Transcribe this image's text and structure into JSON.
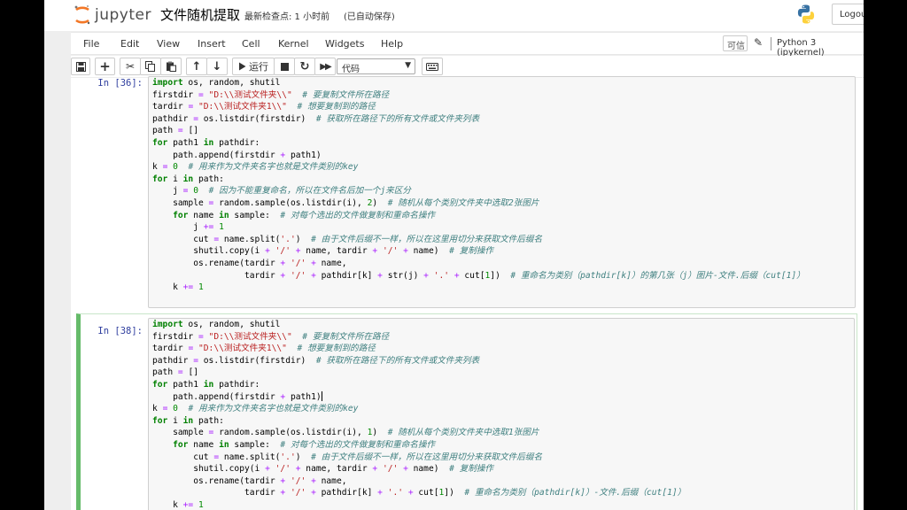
{
  "header": {
    "logo_text": "jupyter",
    "notebook_name": "文件随机提取",
    "checkpoint": "最新检查点: 1 小时前",
    "autosave": "(已自动保存)",
    "logout": "Logou"
  },
  "menubar": {
    "items": [
      "File",
      "Edit",
      "View",
      "Insert",
      "Cell",
      "Kernel",
      "Widgets",
      "Help"
    ],
    "trusted": "可信",
    "kernel": "Python 3 (ipykernel)"
  },
  "toolbar": {
    "run_label": "运行",
    "cell_type": "代码"
  },
  "cells": [
    {
      "prompt": "In  [36]:",
      "lines": [
        "import os, random, shutil",
        "firstdir = \"D:\\\\测试文件夹\\\\\"  # 要复制文件所在路径",
        "tardir = \"D:\\\\测试文件夹1\\\\\"  # 想要复制到的路径",
        "pathdir = os.listdir(firstdir)  # 获取所在路径下的所有文件或文件夹列表",
        "path = []",
        "for path1 in pathdir:",
        "    path.append(firstdir + path1)",
        "k = 0  # 用来作为文件夹名字也就是文件类别的key",
        "for i in path:",
        "    j = 0  # 因为不能重复命名，所以在文件名后加一个j来区分",
        "    sample = random.sample(os.listdir(i), 2)  # 随机从每个类别文件夹中选取2张图片",
        "    for name in sample:  # 对每个选出的文件做复制和重命名操作",
        "        j += 1",
        "        cut = name.split('.')  # 由于文件后缀不一样，所以在这里用切分来获取文件后缀名",
        "        shutil.copy(i + '/' + name, tardir + '/' + name)  # 复制操作",
        "        os.rename(tardir + '/' + name,",
        "                  tardir + '/' + pathdir[k] + str(j) + '.' + cut[1])  # 重命名为类别（pathdir[k]）的第几张（j）图片-文件.后缀（cut[1]）",
        "    k += 1"
      ]
    },
    {
      "prompt": "In  [38]:",
      "lines": [
        "import os, random, shutil",
        "firstdir = \"D:\\\\测试文件夹\\\\\"  # 要复制文件所在路径",
        "tardir = \"D:\\\\测试文件夹1\\\\\"  # 想要复制到的路径",
        "pathdir = os.listdir(firstdir)  # 获取所在路径下的所有文件或文件夹列表",
        "path = []",
        "for path1 in pathdir:",
        "    path.append(firstdir + path1)",
        "k = 0  # 用来作为文件夹名字也就是文件类别的key",
        "for i in path:",
        "    sample = random.sample(os.listdir(i), 1)  # 随机从每个类别文件夹中选取1张图片",
        "    for name in sample:  # 对每个选出的文件做复制和重命名操作",
        "        cut = name.split('.')  # 由于文件后缀不一样，所以在这里用切分来获取文件后缀名",
        "        shutil.copy(i + '/' + name, tardir + '/' + name)  # 复制操作",
        "        os.rename(tardir + '/' + name,",
        "                  tardir + '/' + pathdir[k] + '.' + cut[1])  # 重命名为类别（pathdir[k]）-文件.后缀（cut[1]）",
        "    k += 1"
      ]
    }
  ],
  "colors": {
    "prompt": "#303f9f",
    "keyword": "#008000",
    "string": "#ba2121",
    "comment": "#408080",
    "operator": "#aa22ff",
    "selected_cell": "#66bb6a"
  }
}
